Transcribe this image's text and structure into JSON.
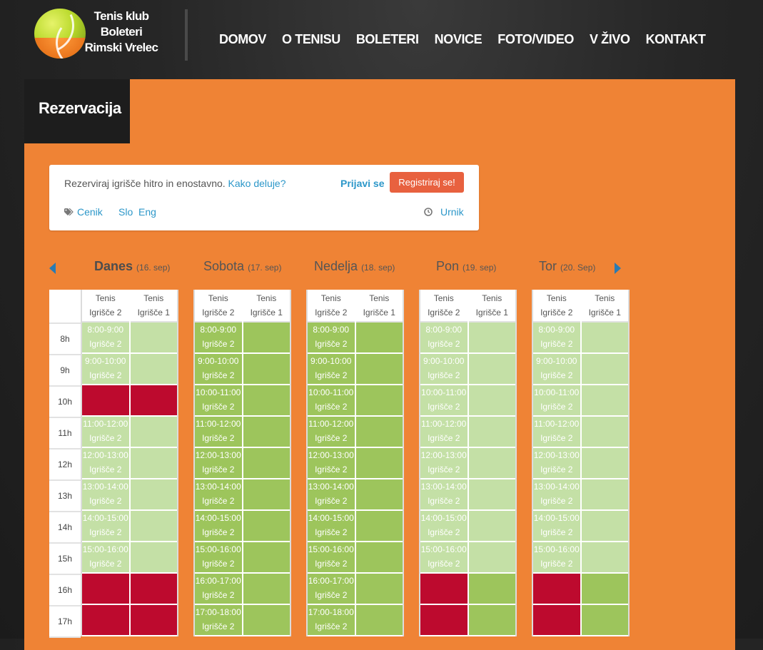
{
  "header": {
    "logo_lines": [
      "Tenis klub",
      "Boleteri",
      "Rimski Vrelec"
    ],
    "nav": [
      "DOMOV",
      "O TENISU",
      "BOLETERI",
      "NOVICE",
      "FOTO/VIDEO",
      "V ŽIVO",
      "KONTAKT"
    ]
  },
  "page": {
    "title": "Rezervacija"
  },
  "info": {
    "intro": "Rezerviraj igrišče hitro in enostavno.",
    "how_link": "Kako deluje?",
    "login": "Prijavi se",
    "register": "Registriraj se!",
    "pricing": "Cenik",
    "lang_slo": "Slo",
    "lang_eng": "Eng",
    "schedule": "Urnik"
  },
  "colors": {
    "panel": "#ef8335",
    "free": "#9dc55c",
    "past": "#c4e0a6",
    "booked": "#bd0a2e",
    "link": "#2c97c9",
    "register": "#e8613f"
  },
  "hours": [
    "8h",
    "9h",
    "10h",
    "11h",
    "12h",
    "13h",
    "14h",
    "15h",
    "16h",
    "17h"
  ],
  "court_header": {
    "line1": "Tenis",
    "court2": "Igrišče 2",
    "court1": "Igrišče 1"
  },
  "days": [
    {
      "name": "Danes",
      "date": "(16. sep)",
      "court2": [
        {
          "s": "past",
          "t": "8:00-9:00",
          "c": "Igrišče 2"
        },
        {
          "s": "past",
          "t": "9:00-10:00",
          "c": "Igrišče 2"
        },
        {
          "s": "booked"
        },
        {
          "s": "past",
          "t": "11:00-12:00",
          "c": "Igrišče 2"
        },
        {
          "s": "past",
          "t": "12:00-13:00",
          "c": "Igrišče 2"
        },
        {
          "s": "past",
          "t": "13:00-14:00",
          "c": "Igrišče 2"
        },
        {
          "s": "past",
          "t": "14:00-15:00",
          "c": "Igrišče 2"
        },
        {
          "s": "past",
          "t": "15:00-16:00",
          "c": "Igrišče 2"
        },
        {
          "s": "booked"
        },
        {
          "s": "booked"
        }
      ],
      "court1": [
        "past",
        "past",
        "booked",
        "past",
        "past",
        "past",
        "past",
        "past",
        "booked",
        "booked"
      ]
    },
    {
      "name": "Sobota",
      "date": "(17. sep)",
      "court2": [
        {
          "s": "free",
          "t": "8:00-9:00",
          "c": "Igrišče 2"
        },
        {
          "s": "free",
          "t": "9:00-10:00",
          "c": "Igrišče 2"
        },
        {
          "s": "free",
          "t": "10:00-11:00",
          "c": "Igrišče 2"
        },
        {
          "s": "free",
          "t": "11:00-12:00",
          "c": "Igrišče 2"
        },
        {
          "s": "free",
          "t": "12:00-13:00",
          "c": "Igrišče 2"
        },
        {
          "s": "free",
          "t": "13:00-14:00",
          "c": "Igrišče 2"
        },
        {
          "s": "free",
          "t": "14:00-15:00",
          "c": "Igrišče 2"
        },
        {
          "s": "free",
          "t": "15:00-16:00",
          "c": "Igrišče 2"
        },
        {
          "s": "free",
          "t": "16:00-17:00",
          "c": "Igrišče 2"
        },
        {
          "s": "free",
          "t": "17:00-18:00",
          "c": "Igrišče 2"
        }
      ],
      "court1": [
        "free",
        "free",
        "free",
        "free",
        "free",
        "free",
        "free",
        "free",
        "free",
        "free"
      ]
    },
    {
      "name": "Nedelja",
      "date": "(18. sep)",
      "court2": [
        {
          "s": "free",
          "t": "8:00-9:00",
          "c": "Igrišče 2"
        },
        {
          "s": "free",
          "t": "9:00-10:00",
          "c": "Igrišče 2"
        },
        {
          "s": "free",
          "t": "10:00-11:00",
          "c": "Igrišče 2"
        },
        {
          "s": "free",
          "t": "11:00-12:00",
          "c": "Igrišče 2"
        },
        {
          "s": "free",
          "t": "12:00-13:00",
          "c": "Igrišče 2"
        },
        {
          "s": "free",
          "t": "13:00-14:00",
          "c": "Igrišče 2"
        },
        {
          "s": "free",
          "t": "14:00-15:00",
          "c": "Igrišče 2"
        },
        {
          "s": "free",
          "t": "15:00-16:00",
          "c": "Igrišče 2"
        },
        {
          "s": "free",
          "t": "16:00-17:00",
          "c": "Igrišče 2"
        },
        {
          "s": "free",
          "t": "17:00-18:00",
          "c": "Igrišče 2"
        }
      ],
      "court1": [
        "free",
        "free",
        "free",
        "free",
        "free",
        "free",
        "free",
        "free",
        "free",
        "free"
      ]
    },
    {
      "name": "Pon",
      "date": "(19. sep)",
      "court2": [
        {
          "s": "past",
          "t": "8:00-9:00",
          "c": "Igrišče 2"
        },
        {
          "s": "past",
          "t": "9:00-10:00",
          "c": "Igrišče 2"
        },
        {
          "s": "past",
          "t": "10:00-11:00",
          "c": "Igrišče 2"
        },
        {
          "s": "past",
          "t": "11:00-12:00",
          "c": "Igrišče 2"
        },
        {
          "s": "past",
          "t": "12:00-13:00",
          "c": "Igrišče 2"
        },
        {
          "s": "past",
          "t": "13:00-14:00",
          "c": "Igrišče 2"
        },
        {
          "s": "past",
          "t": "14:00-15:00",
          "c": "Igrišče 2"
        },
        {
          "s": "past",
          "t": "15:00-16:00",
          "c": "Igrišče 2"
        },
        {
          "s": "booked"
        },
        {
          "s": "booked"
        }
      ],
      "court1": [
        "past",
        "past",
        "past",
        "past",
        "past",
        "past",
        "past",
        "past",
        "free",
        "free"
      ]
    },
    {
      "name": "Tor",
      "date": "(20. Sep)",
      "court2": [
        {
          "s": "past",
          "t": "8:00-9:00",
          "c": "Igrišče 2"
        },
        {
          "s": "past",
          "t": "9:00-10:00",
          "c": "Igrišče 2"
        },
        {
          "s": "past",
          "t": "10:00-11:00",
          "c": "Igrišče 2"
        },
        {
          "s": "past",
          "t": "11:00-12:00",
          "c": "Igrišče 2"
        },
        {
          "s": "past",
          "t": "12:00-13:00",
          "c": "Igrišče 2"
        },
        {
          "s": "past",
          "t": "13:00-14:00",
          "c": "Igrišče 2"
        },
        {
          "s": "past",
          "t": "14:00-15:00",
          "c": "Igrišče 2"
        },
        {
          "s": "past",
          "t": "15:00-16:00",
          "c": "Igrišče 2"
        },
        {
          "s": "booked"
        },
        {
          "s": "booked"
        }
      ],
      "court1": [
        "past",
        "past",
        "past",
        "past",
        "past",
        "past",
        "past",
        "past",
        "free",
        "free"
      ]
    }
  ]
}
